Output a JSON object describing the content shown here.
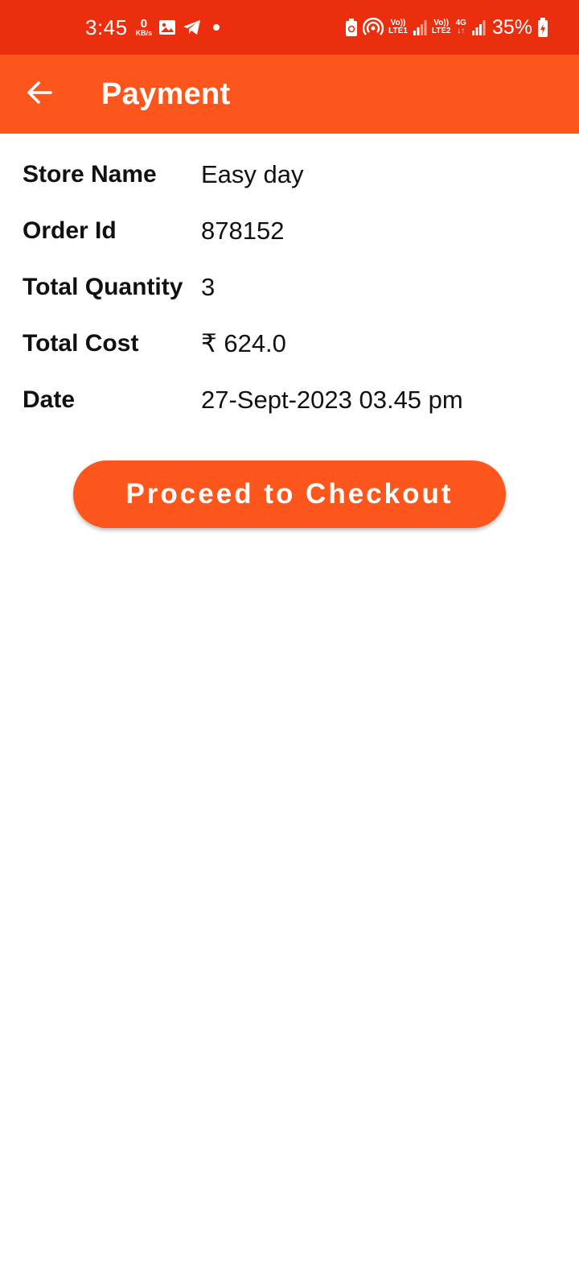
{
  "status_bar": {
    "time": "3:45",
    "net_speed_value": "0",
    "net_speed_unit": "KB/s",
    "sim1_top": "Vo))",
    "sim1_bottom": "LTE1",
    "sim2_top": "Vo))",
    "sim2_bottom": "LTE2",
    "network_type": "4G",
    "battery": "35%",
    "icons": [
      "gallery-icon",
      "telegram-icon",
      "notification-dot",
      "battery-saver-icon",
      "hotspot-icon",
      "signal-icon",
      "signal-icon",
      "battery-charging-icon"
    ]
  },
  "app_bar": {
    "title": "Payment",
    "back_icon": "arrow-left-icon"
  },
  "details": {
    "rows": [
      {
        "label": "Store Name",
        "value": "Easy day"
      },
      {
        "label": "Order Id",
        "value": "878152"
      },
      {
        "label": "Total Quantity",
        "value": "3"
      },
      {
        "label": "Total Cost",
        "value": "₹ 624.0"
      },
      {
        "label": "Date",
        "value": "27-Sept-2023 03.45 pm"
      }
    ]
  },
  "actions": {
    "checkout_label": "Proceed to Checkout"
  },
  "colors": {
    "status_bar": "#EA2E0E",
    "accent": "#FD561C",
    "text": "#111111",
    "background": "#FFFFFF"
  }
}
